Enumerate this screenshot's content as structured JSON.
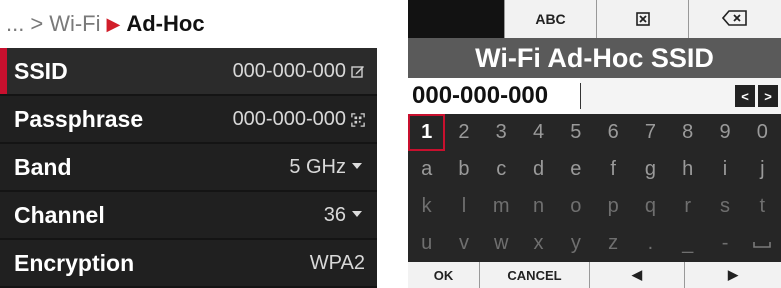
{
  "colors": {
    "accent": "#c8102e",
    "panel_bg": "#202020",
    "title_bg": "#5a5a5a"
  },
  "breadcrumb": {
    "ellipsis": "...",
    "parent": "Wi-Fi",
    "current": "Ad-Hoc",
    "separator": ">"
  },
  "settings": [
    {
      "label": "SSID",
      "value": "000-000-000",
      "icon": "edit-icon"
    },
    {
      "label": "Passphrase",
      "value": "000-000-000",
      "icon": "qr-scan-icon"
    },
    {
      "label": "Band",
      "value": "5 GHz",
      "icon": "chevron-down-icon"
    },
    {
      "label": "Channel",
      "value": "36",
      "icon": "chevron-down-icon"
    },
    {
      "label": "Encryption",
      "value": "WPA2"
    }
  ],
  "keyboard": {
    "top": {
      "abc": "ABC",
      "clear_icon": "clear-box-icon",
      "backspace_icon": "backspace-icon"
    },
    "title": "Wi-Fi Ad-Hoc SSID",
    "input_value": "000-000-000",
    "arrows": {
      "left": "<",
      "right": ">"
    },
    "rows": [
      [
        "1",
        "2",
        "3",
        "4",
        "5",
        "6",
        "7",
        "8",
        "9",
        "0"
      ],
      [
        "a",
        "b",
        "c",
        "d",
        "e",
        "f",
        "g",
        "h",
        "i",
        "j"
      ],
      [
        "k",
        "l",
        "m",
        "n",
        "o",
        "p",
        "q",
        "r",
        "s",
        "t"
      ],
      [
        "u",
        "v",
        "w",
        "x",
        "y",
        "z",
        ".",
        "_",
        "-",
        ""
      ]
    ],
    "selected_key": "1",
    "bottom": {
      "ok": "OK",
      "cancel": "CANCEL",
      "left": "◀",
      "right": "▶"
    }
  }
}
